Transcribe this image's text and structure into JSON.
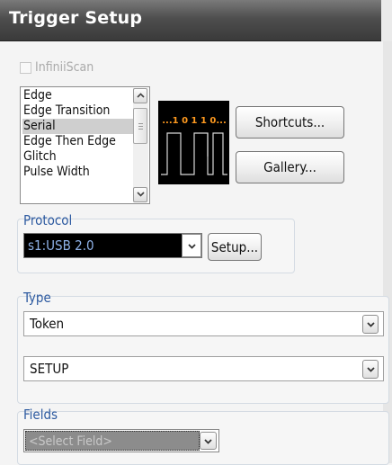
{
  "window": {
    "title": "Trigger Setup"
  },
  "infiniiscan": {
    "label": "InfiniiScan",
    "checked": false,
    "enabled": false
  },
  "trigger_list": {
    "items": [
      "Edge",
      "Edge Transition",
      "Serial",
      "Edge Then Edge",
      "Glitch",
      "Pulse Width"
    ],
    "selected": "Serial"
  },
  "preview": {
    "bits": "...1 0 1 1 0...",
    "bit_color": "#ff9a1f"
  },
  "buttons": {
    "shortcuts": "Shortcuts...",
    "gallery": "Gallery...",
    "setup": "Setup..."
  },
  "protocol": {
    "label": "Protocol",
    "value": "s1:USB 2.0"
  },
  "type": {
    "label": "Type",
    "primary": "Token",
    "secondary": "SETUP"
  },
  "fields": {
    "label": "Fields",
    "value": "<Select Field>"
  },
  "colors": {
    "title_text": "#ffffff",
    "group_label": "#2d5aa0",
    "protocol_text": "#8fb2e8"
  }
}
